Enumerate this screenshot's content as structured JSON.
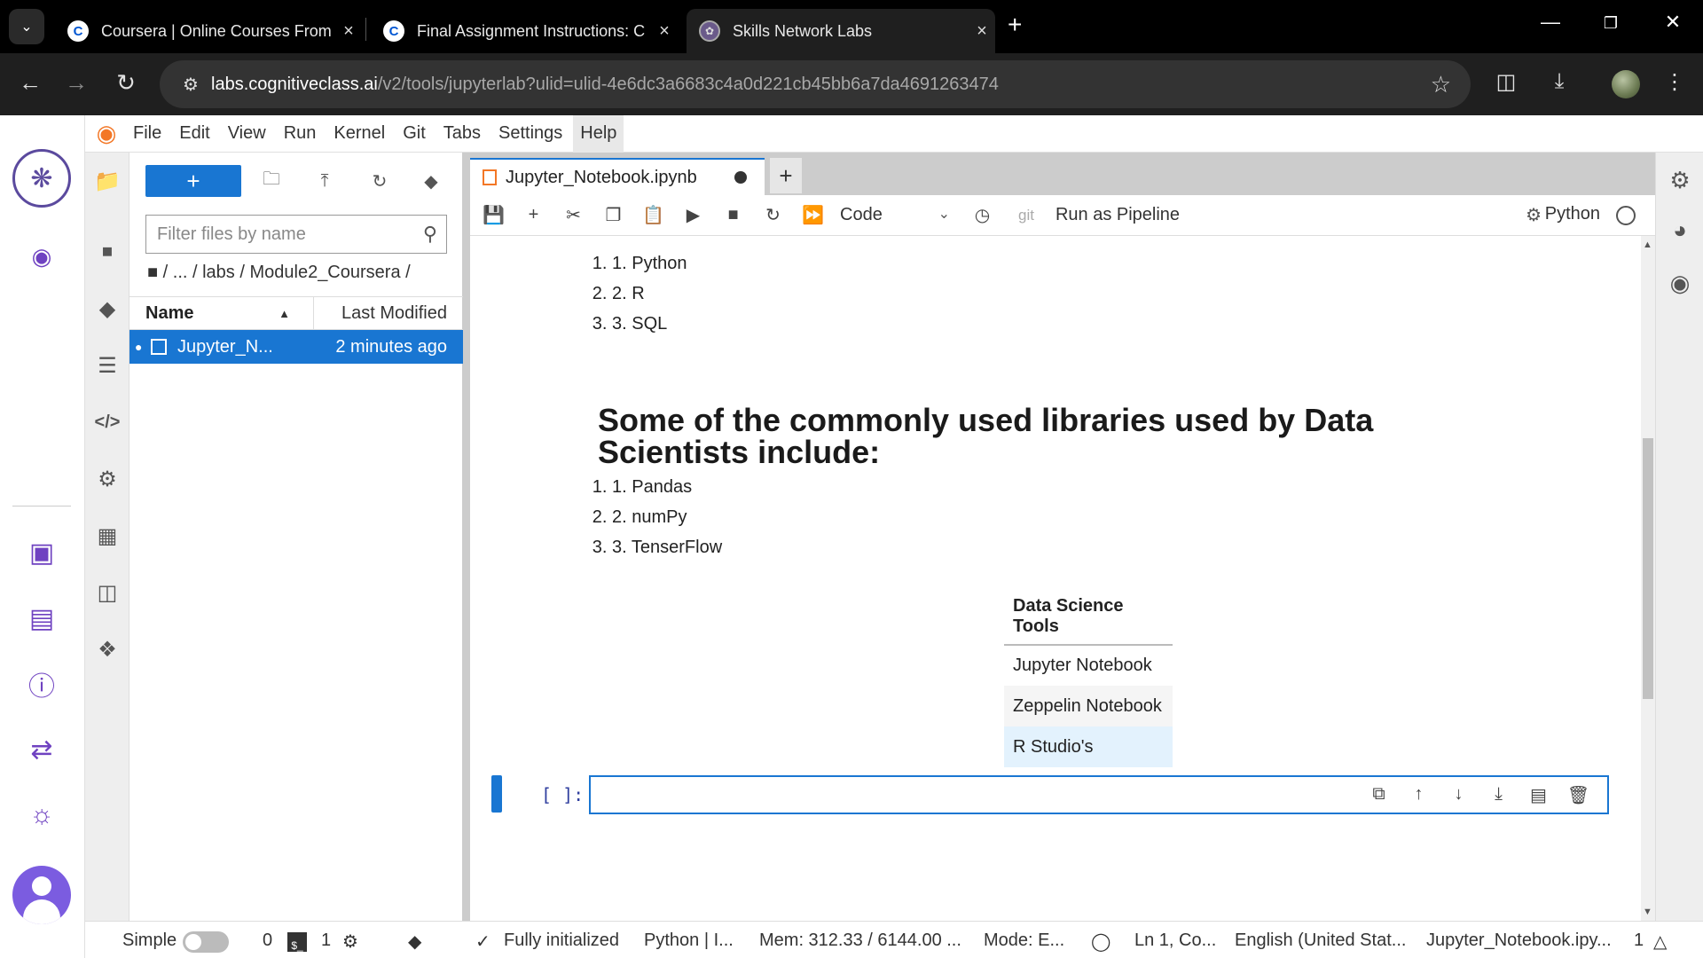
{
  "browser": {
    "tabs": [
      {
        "title": "Coursera | Online Courses From",
        "favicon": "C",
        "favicon_color": "#0056d2"
      },
      {
        "title": "Final Assignment Instructions: C",
        "favicon": "C",
        "favicon_color": "#0056d2"
      },
      {
        "title": "Skills Network Labs",
        "favicon": "snl-icon",
        "active": true
      }
    ],
    "url_host": "labs.cognitiveclass.ai",
    "url_path": "/v2/tools/jupyterlab?ulid=ulid-4e6dc3a6683c4a0d221cb45bb6a7da4691263474"
  },
  "menubar": {
    "items": [
      "File",
      "Edit",
      "View",
      "Run",
      "Kernel",
      "Git",
      "Tabs",
      "Settings",
      "Help"
    ],
    "highlighted": "Help"
  },
  "filebrowser": {
    "new_label": "+",
    "filter_placeholder": "Filter files by name",
    "breadcrumbs": "/ ... / labs / Module2_Coursera /",
    "col_name": "Name",
    "col_modified": "Last Modified",
    "files": [
      {
        "name": "Jupyter_N...",
        "modified": "2 minutes ago",
        "selected": true
      }
    ]
  },
  "notebook": {
    "tab_title": "Jupyter_Notebook.ipynb",
    "cell_type": "Code",
    "git_label": "git",
    "pipeline_label": "Run as Pipeline",
    "kernel_name": "Python",
    "languages": [
      "Python",
      "R",
      "SQL"
    ],
    "libraries_heading": "Some of the commonly used libraries used by Data Scientists include:",
    "libraries": [
      "Pandas",
      "numPy",
      "TenserFlow"
    ],
    "tools_table": {
      "header": "Data Science Tools",
      "rows": [
        "Jupyter Notebook",
        "Zeppelin Notebook",
        "R Studio's"
      ]
    },
    "cell_prompt": "[ ]:"
  },
  "statusbar": {
    "mode_label": "Simple",
    "terminals": "0",
    "kernels": "1",
    "init_status": "Fully initialized",
    "kernel": "Python | I...",
    "mem": "Mem: 312.33 / 6144.00 ...",
    "mode": "Mode: E...",
    "position": "Ln 1, Co...",
    "language": "English (United Stat...",
    "filename": "Jupyter_Notebook.ipy...",
    "notifications": "1"
  },
  "colors": {
    "accent": "#1976d2",
    "jupyter_orange": "#f37726",
    "rail_purple": "#6f42c1"
  }
}
